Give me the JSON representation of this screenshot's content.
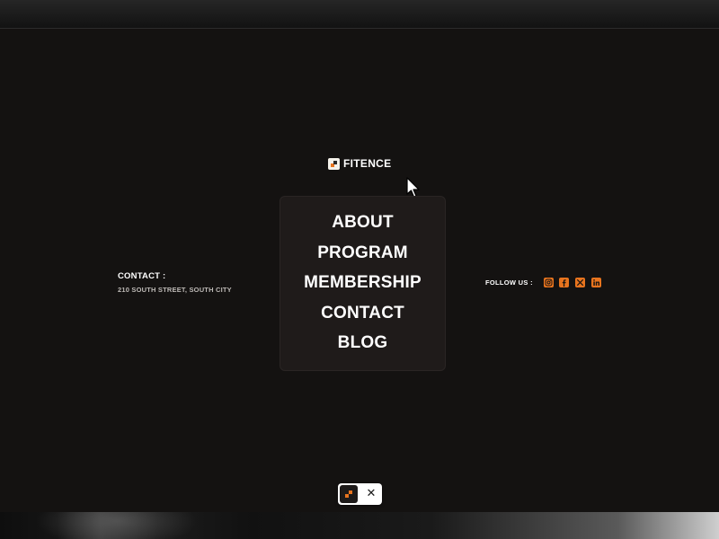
{
  "brand": {
    "name": "FITENCE",
    "accent_color": "#e8741e"
  },
  "menu": {
    "items": [
      {
        "label": "ABOUT"
      },
      {
        "label": "PROGRAM"
      },
      {
        "label": "MEMBERSHIP"
      },
      {
        "label": "CONTACT"
      },
      {
        "label": "BLOG"
      }
    ]
  },
  "contact": {
    "title": "CONTACT :",
    "address": "210 SOUTH STREET, SOUTH CITY"
  },
  "follow": {
    "label": "FOLLOW US :",
    "icons": [
      "instagram-icon",
      "facebook-icon",
      "x-icon",
      "linkedin-icon"
    ]
  },
  "toolbar": {
    "toggle_icon": "logo-mark-icon",
    "close_glyph": "✕"
  }
}
